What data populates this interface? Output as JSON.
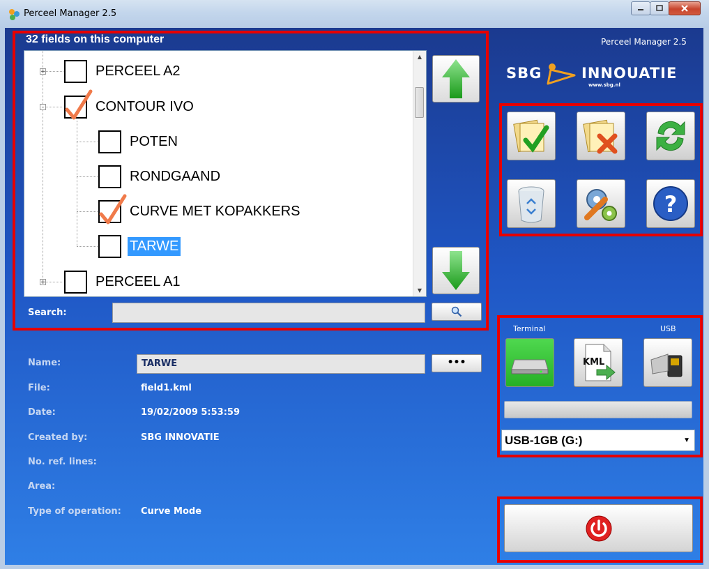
{
  "window": {
    "title": "Perceel Manager 2.5"
  },
  "brand": {
    "version": "Perceel Manager 2.5",
    "logo_left": "SBG",
    "logo_right": "INNOUATIE",
    "logo_url": "www.sbg.nl"
  },
  "tree": {
    "header": "32 fields on this computer",
    "nodes": [
      {
        "label": "PERCEEL A2",
        "checked": false,
        "expander": "+"
      },
      {
        "label": "CONTOUR IVO",
        "checked": true,
        "expander": "-"
      },
      {
        "label": "POTEN",
        "checked": false
      },
      {
        "label": "RONDGAAND",
        "checked": false
      },
      {
        "label": "CURVE MET KOPAKKERS",
        "checked": true
      },
      {
        "label": "TARWE",
        "checked": false,
        "selected": true
      },
      {
        "label": "PERCEEL A1",
        "checked": false,
        "expander": "+"
      }
    ]
  },
  "search": {
    "label": "Search:",
    "value": ""
  },
  "details": {
    "name_label": "Name:",
    "name_value": "TARWE",
    "browse_label": "•••",
    "file_label": "File:",
    "file_value": "field1.kml",
    "date_label": "Date:",
    "date_value": "19/02/2009 5:53:59",
    "created_label": "Created by:",
    "created_value": "SBG INNOVATIE",
    "reflines_label": "No. ref. lines:",
    "reflines_value": "",
    "area_label": "Area:",
    "area_value": "",
    "operation_label": "Type of operation:",
    "operation_value": "Curve Mode"
  },
  "actions": {
    "icons": [
      "check-documents-icon",
      "uncheck-documents-icon",
      "refresh-icon",
      "recycle-bin-icon",
      "settings-tools-icon",
      "help-icon"
    ]
  },
  "transfer": {
    "terminal_label": "Terminal",
    "usb_label": "USB",
    "kml_label": "KML",
    "progress": 0,
    "drive": "USB-1GB (G:)"
  },
  "colors": {
    "accent_red": "#e60000",
    "active_green": "#2bbf2b",
    "bg_blue": "#1f56c4"
  }
}
